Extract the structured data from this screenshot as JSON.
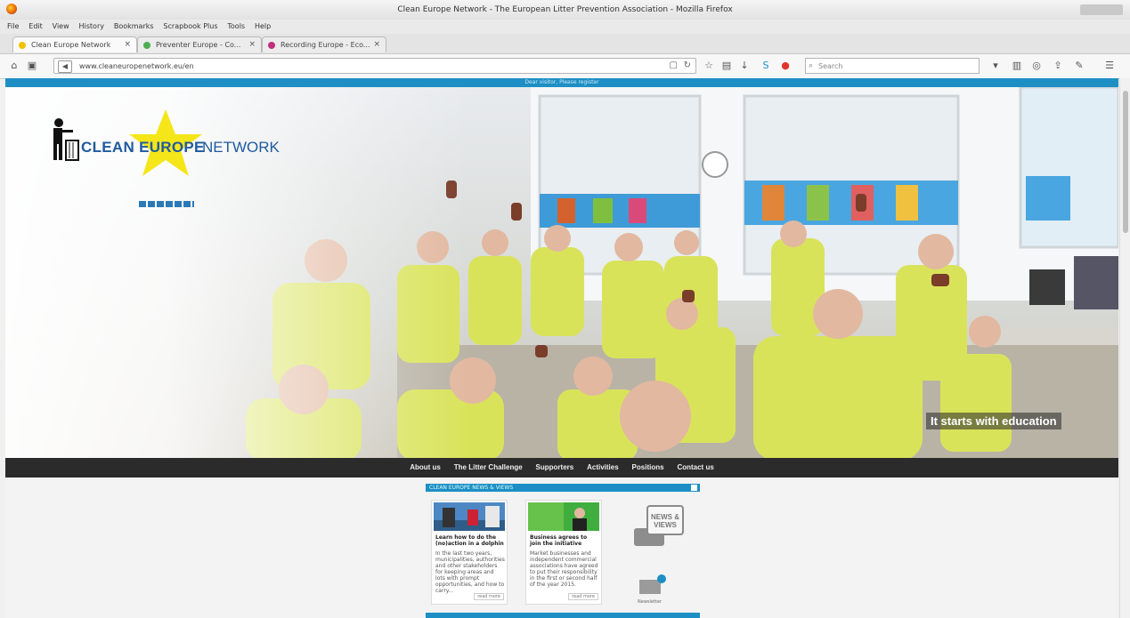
{
  "browser": {
    "window_title": "Clean Europe Network - The European Litter Prevention Association - Mozilla Firefox",
    "menu": [
      "File",
      "Edit",
      "View",
      "History",
      "Bookmarks",
      "Scrapbook Plus",
      "Tools",
      "Help"
    ],
    "tabs": [
      {
        "label": "Clean Europe Network",
        "active": true,
        "icon_color": "#f2c200"
      },
      {
        "label": "Preventer Europe - Co...",
        "active": false,
        "icon_color": "#4caf50"
      },
      {
        "label": "Recording Europe - Eco...",
        "active": false,
        "icon_color": "#c0307a"
      }
    ],
    "url": "www.cleaneuropenetwork.eu/en",
    "search_placeholder": "Search"
  },
  "page": {
    "top_strip_text": "Dear visitor, Please register",
    "logo": {
      "part1": "CLEAN EUROPE",
      "part2": "NETWORK"
    },
    "hero_tagline": "It starts with education",
    "nav": [
      "About us",
      "The Litter Challenge",
      "Supporters",
      "Activities",
      "Positions",
      "Contact us"
    ],
    "news_header": "CLEAN EUROPE NEWS & VIEWS",
    "news": [
      {
        "title": "Learn how to do the (no)action in a dolphin",
        "text": "In the last two years, municipalities, authorities and other stakeholders for keeping areas and lots with prompt opportunities, and how to carry...",
        "more": "read more"
      },
      {
        "title": "Business agrees to join the initiative",
        "text": "Market businesses and independent commercial associations have agreed to put their responsibility in the first or second half of the year 2015.",
        "more": "read more"
      }
    ],
    "views_label": "NEWS & VIEWS",
    "newsletter_label": "Newsletter"
  }
}
